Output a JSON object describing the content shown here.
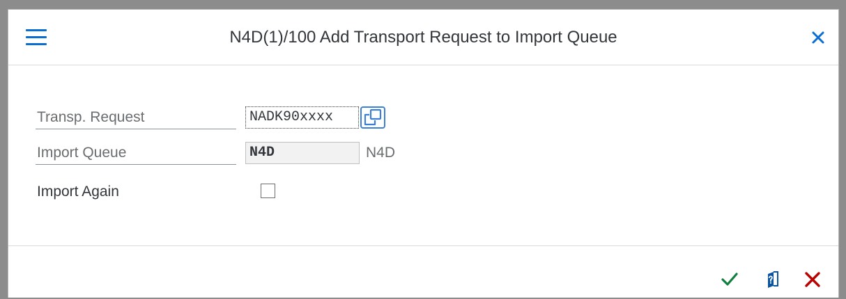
{
  "dialog": {
    "title": "N4D(1)/100 Add Transport Request to Import Queue"
  },
  "form": {
    "transport_request": {
      "label": "Transp. Request",
      "value": "NADK90xxxx"
    },
    "import_queue": {
      "label": "Import Queue",
      "value": "N4D",
      "description": "N4D"
    },
    "import_again": {
      "label": "Import Again",
      "checked": false
    }
  },
  "colors": {
    "accent": "#0a6ed1",
    "confirm": "#107e3e",
    "cancel": "#bb0000"
  },
  "icons": {
    "menu": "hamburger-menu-icon",
    "close": "close-icon",
    "value_help": "value-help-icon",
    "confirm": "checkmark-icon",
    "help": "help-document-icon",
    "cancel": "cancel-x-icon"
  }
}
